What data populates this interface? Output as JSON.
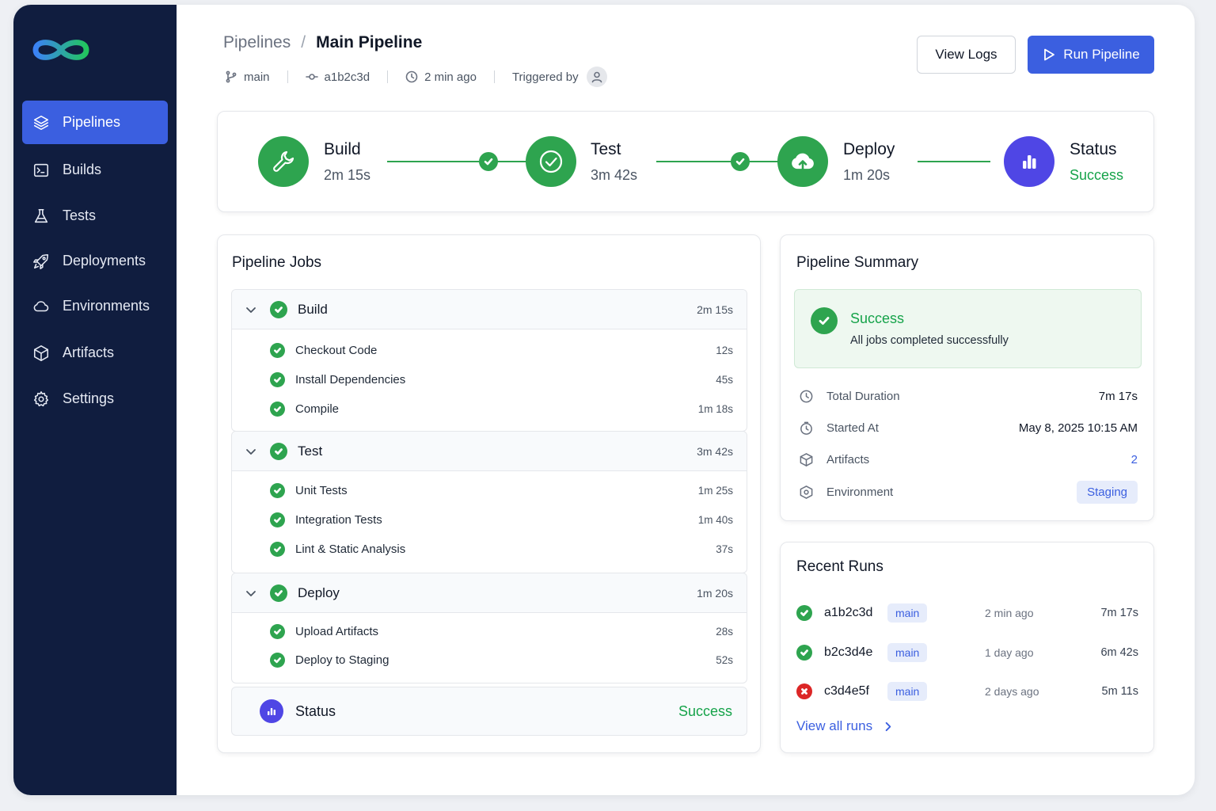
{
  "sidebar": {
    "items": [
      {
        "label": "Pipelines",
        "icon": "layers-icon",
        "active": true
      },
      {
        "label": "Builds",
        "icon": "terminal-icon"
      },
      {
        "label": "Tests",
        "icon": "flask-icon"
      },
      {
        "label": "Deployments",
        "icon": "rocket-icon"
      },
      {
        "label": "Environments",
        "icon": "cloud-icon"
      },
      {
        "label": "Artifacts",
        "icon": "box-icon"
      },
      {
        "label": "Settings",
        "icon": "gear-icon"
      }
    ]
  },
  "header": {
    "breadcrumb_parent": "Pipelines",
    "breadcrumb_sep": "/",
    "title": "Main Pipeline",
    "branch": "main",
    "commit": "a1b2c3d",
    "time": "2 min ago",
    "triggered_by": "Triggered by",
    "view_logs": "View Logs",
    "run_pipeline": "Run Pipeline"
  },
  "stages": [
    {
      "name": "Build",
      "duration": "2m 15s",
      "icon": "wrench-icon"
    },
    {
      "name": "Test",
      "duration": "3m 42s",
      "icon": "check-circle-icon"
    },
    {
      "name": "Deploy",
      "duration": "1m 20s",
      "icon": "cloud-upload-icon"
    },
    {
      "name": "Status",
      "duration": "Success",
      "icon": "bar-chart-icon"
    }
  ],
  "jobs": {
    "title": "Pipeline Jobs",
    "groups": [
      {
        "name": "Build",
        "duration": "2m 15s",
        "jobs": [
          {
            "name": "Checkout Code",
            "duration": "12s"
          },
          {
            "name": "Install Dependencies",
            "duration": "45s"
          },
          {
            "name": "Compile",
            "duration": "1m 18s"
          }
        ]
      },
      {
        "name": "Test",
        "duration": "3m 42s",
        "jobs": [
          {
            "name": "Unit Tests",
            "duration": "1m 25s"
          },
          {
            "name": "Integration Tests",
            "duration": "1m 40s"
          },
          {
            "name": "Lint & Static Analysis",
            "duration": "37s"
          }
        ]
      },
      {
        "name": "Deploy",
        "duration": "1m 20s",
        "jobs": [
          {
            "name": "Upload Artifacts",
            "duration": "28s"
          },
          {
            "name": "Deploy to Staging",
            "duration": "52s"
          }
        ]
      }
    ],
    "status_label": "Status",
    "status_value": "Success"
  },
  "summary": {
    "title": "Pipeline Summary",
    "status": "Success",
    "status_sub": "All jobs completed successfully",
    "rows": [
      {
        "label": "Total Duration",
        "value": "7m 17s"
      },
      {
        "label": "Started At",
        "value": "May 8, 2025 10:15 AM"
      },
      {
        "label": "Artifacts",
        "value": "2"
      },
      {
        "label": "Environment",
        "value": "Staging"
      }
    ]
  },
  "recent": {
    "title": "Recent Runs",
    "runs": [
      {
        "hash": "a1b2c3d",
        "branch": "main",
        "time": "2 min ago",
        "duration": "7m 17s",
        "status": "success"
      },
      {
        "hash": "b2c3d4e",
        "branch": "main",
        "time": "1 day ago",
        "duration": "6m 42s",
        "status": "success"
      },
      {
        "hash": "c3d4e5f",
        "branch": "main",
        "time": "2 days ago",
        "duration": "5m 11s",
        "status": "failed"
      }
    ],
    "view_all": "View all runs"
  },
  "colors": {
    "sidebar_bg": "#101d3f",
    "accent": "#3b5fe0",
    "success": "#2ea44f",
    "status_purple": "#4f46e5",
    "error": "#dc2626"
  }
}
